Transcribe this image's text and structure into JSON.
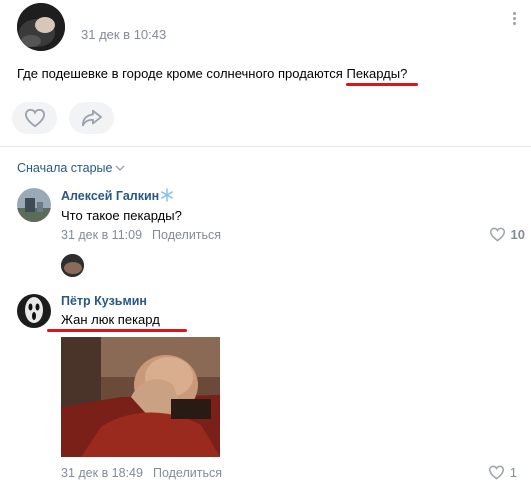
{
  "post": {
    "date": "31 дек в 10:43",
    "text_before": "Где подешевке в городе кроме солнечного продаются ",
    "text_highlight": "Пекарды?"
  },
  "comments_header": {
    "sort_label": "Сначала старые"
  },
  "comments": [
    {
      "author": "Алексей Галкин",
      "text": "Что такое пекарды?",
      "date": "31 дек в 11:09",
      "share": "Поделиться",
      "likes": "10"
    },
    {
      "author": "Пётр Кузьмин",
      "text": "Жан люк пекард",
      "date": "31 дек в 18:49",
      "share": "Поделиться",
      "likes": "1"
    }
  ],
  "colors": {
    "link": "#2a5885",
    "meta": "#818c99",
    "highlight_underline": "#e0121b"
  }
}
